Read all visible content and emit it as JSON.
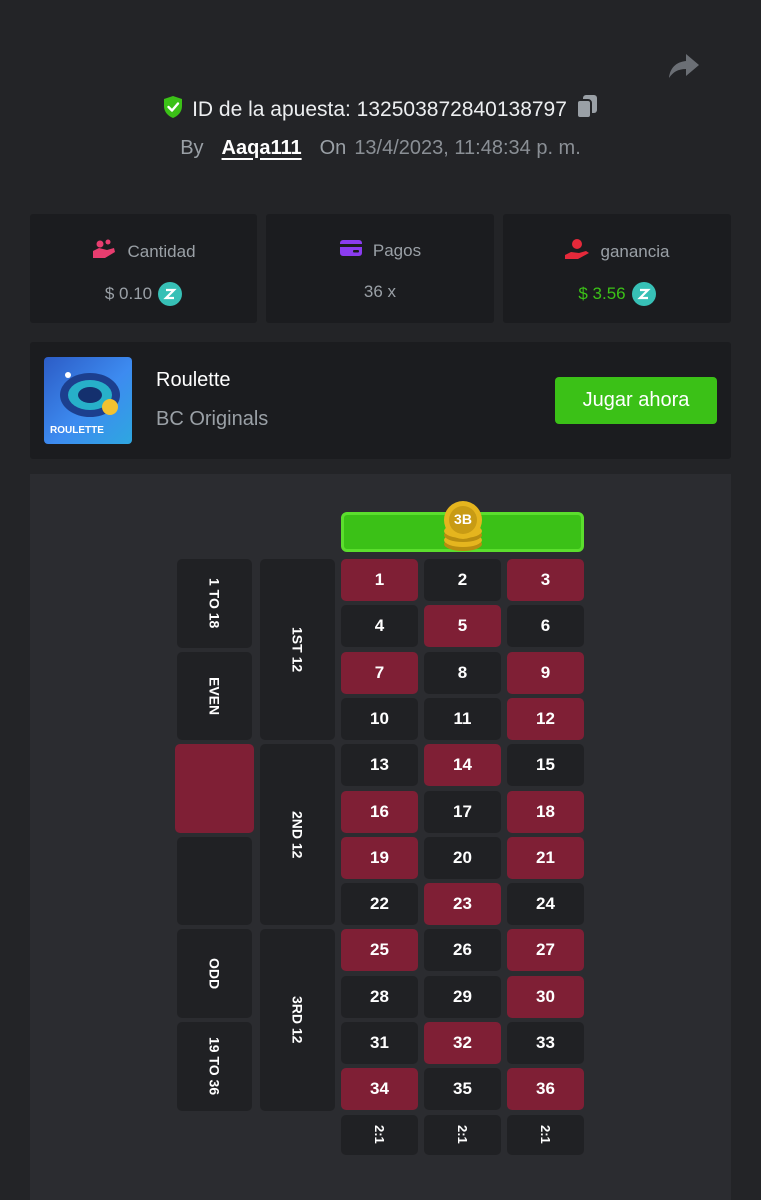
{
  "header": {
    "bet_id_label": "ID de la apuesta: 132503872840138797",
    "by_label": "By",
    "username": "Aaqa111",
    "on_label": "On",
    "datetime": "13/4/2023, 11:48:34 p. m."
  },
  "stats": {
    "amount": {
      "label": "Cantidad",
      "value": "$ 0.10"
    },
    "payout": {
      "label": "Pagos",
      "value": "36 x"
    },
    "profit": {
      "label": "ganancia",
      "value": "$ 3.56"
    }
  },
  "game": {
    "thumb_label": "ROULETTE",
    "name": "Roulette",
    "provider": "BC Originals",
    "play_label": "Jugar ahora"
  },
  "board": {
    "chip_label": "3B",
    "outside_bets": [
      "1 TO 18",
      "EVEN",
      "",
      "",
      "ODD",
      "19 TO 36"
    ],
    "dozens": [
      "1ST 12",
      "2ND 12",
      "3RD 12"
    ],
    "numbers": [
      [
        "1",
        "2",
        "3"
      ],
      [
        "4",
        "5",
        "6"
      ],
      [
        "7",
        "8",
        "9"
      ],
      [
        "10",
        "11",
        "12"
      ],
      [
        "13",
        "14",
        "15"
      ],
      [
        "16",
        "17",
        "18"
      ],
      [
        "19",
        "20",
        "21"
      ],
      [
        "22",
        "23",
        "24"
      ],
      [
        "25",
        "26",
        "27"
      ],
      [
        "28",
        "29",
        "30"
      ],
      [
        "31",
        "32",
        "33"
      ],
      [
        "34",
        "35",
        "36"
      ]
    ],
    "column_bets": [
      "2:1",
      "2:1",
      "2:1"
    ],
    "red_numbers": [
      1,
      3,
      5,
      7,
      9,
      12,
      14,
      16,
      18,
      19,
      21,
      23,
      25,
      27,
      30,
      32,
      34,
      36
    ]
  },
  "colors": {
    "green": "#3bc117",
    "red_cell": "#7f1f35",
    "black_cell": "#202124",
    "profit_text": "#3bc117",
    "coin": "#37c0b6"
  },
  "icons": {
    "share": "share-arrow-icon",
    "shield": "shield-check-icon",
    "copy": "copy-icon",
    "amount": "coins-hand-icon",
    "payout": "wallet-card-icon",
    "profit": "hand-money-icon"
  }
}
